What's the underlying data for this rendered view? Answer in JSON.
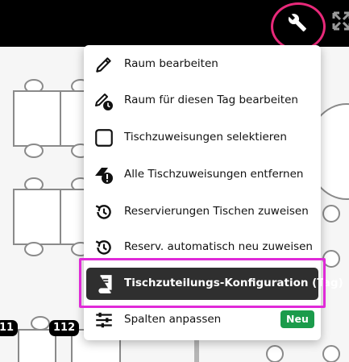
{
  "toolbar": {
    "tools_icon": "wrench-icon",
    "expand_icon": "expand-icon"
  },
  "floorplan": {
    "table_badges": [
      "11",
      "112"
    ]
  },
  "menu": {
    "items": [
      {
        "label": "Raum bearbeiten",
        "icon": "pencil-icon"
      },
      {
        "label": "Raum für diesen Tag bearbeiten",
        "icon": "pencil-clock-icon"
      },
      {
        "label": "Tischzuweisungen selektieren",
        "icon": "checkbox-icon"
      },
      {
        "label": "Alle Tischzuweisungen entfernen",
        "icon": "eraser-alert-icon"
      },
      {
        "label": "Reservierungen Tischen zuweisen",
        "icon": "history-icon"
      },
      {
        "label": "Reserv. automatisch neu zuweisen",
        "icon": "history-icon"
      },
      {
        "label": "Tischzuteilungs-Konfiguration (Tag)",
        "icon": "book-icon",
        "active": true
      },
      {
        "label": "Spalten anpassen",
        "icon": "sliders-icon",
        "badge": "Neu"
      }
    ]
  },
  "colors": {
    "topbar": "#000000",
    "active_item": "#2f2f2f",
    "new_badge": "#1b9b4b",
    "annotation_pink": "#e02ad8"
  }
}
